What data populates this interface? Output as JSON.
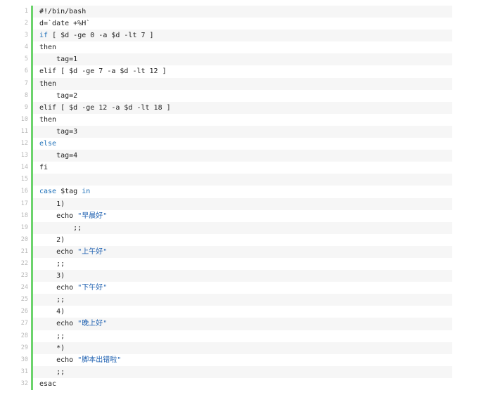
{
  "code": {
    "lines": [
      {
        "number": "1",
        "parts": [
          {
            "t": "#!/bin/bash",
            "c": "comment"
          }
        ]
      },
      {
        "number": "2",
        "parts": [
          {
            "t": "d=`date +%H`",
            "c": "plain"
          }
        ]
      },
      {
        "number": "3",
        "parts": [
          {
            "t": "if",
            "c": "kw"
          },
          {
            "t": " [ $d -ge 0 -a $d -lt 7 ]",
            "c": "plain"
          }
        ]
      },
      {
        "number": "4",
        "parts": [
          {
            "t": "then",
            "c": "plain"
          }
        ]
      },
      {
        "number": "5",
        "parts": [
          {
            "t": "    tag=1",
            "c": "plain"
          }
        ]
      },
      {
        "number": "6",
        "parts": [
          {
            "t": "elif [ $d -ge 7 -a $d -lt 12 ]",
            "c": "plain"
          }
        ]
      },
      {
        "number": "7",
        "parts": [
          {
            "t": "then",
            "c": "plain"
          }
        ]
      },
      {
        "number": "8",
        "parts": [
          {
            "t": "    tag=2",
            "c": "plain"
          }
        ]
      },
      {
        "number": "9",
        "parts": [
          {
            "t": "elif [ $d -ge 12 -a $d -lt 18 ]",
            "c": "plain"
          }
        ]
      },
      {
        "number": "10",
        "parts": [
          {
            "t": "then",
            "c": "plain"
          }
        ]
      },
      {
        "number": "11",
        "parts": [
          {
            "t": "    tag=3",
            "c": "plain"
          }
        ]
      },
      {
        "number": "12",
        "parts": [
          {
            "t": "else",
            "c": "kw"
          }
        ]
      },
      {
        "number": "13",
        "parts": [
          {
            "t": "    tag=4",
            "c": "plain"
          }
        ]
      },
      {
        "number": "14",
        "parts": [
          {
            "t": "fi",
            "c": "plain"
          }
        ]
      },
      {
        "number": "15",
        "parts": [
          {
            "t": "",
            "c": "plain"
          }
        ]
      },
      {
        "number": "16",
        "parts": [
          {
            "t": "case",
            "c": "kw"
          },
          {
            "t": " $tag ",
            "c": "plain"
          },
          {
            "t": "in",
            "c": "kw"
          }
        ]
      },
      {
        "number": "17",
        "parts": [
          {
            "t": "    1)",
            "c": "plain"
          }
        ]
      },
      {
        "number": "18",
        "parts": [
          {
            "t": "    echo ",
            "c": "plain"
          },
          {
            "t": "\"早晨好\"",
            "c": "str"
          }
        ]
      },
      {
        "number": "19",
        "parts": [
          {
            "t": "        ;;",
            "c": "plain"
          }
        ]
      },
      {
        "number": "20",
        "parts": [
          {
            "t": "    2)",
            "c": "plain"
          }
        ]
      },
      {
        "number": "21",
        "parts": [
          {
            "t": "    echo ",
            "c": "plain"
          },
          {
            "t": "\"上午好\"",
            "c": "str"
          }
        ]
      },
      {
        "number": "22",
        "parts": [
          {
            "t": "    ;;",
            "c": "plain"
          }
        ]
      },
      {
        "number": "23",
        "parts": [
          {
            "t": "    3)",
            "c": "plain"
          }
        ]
      },
      {
        "number": "24",
        "parts": [
          {
            "t": "    echo ",
            "c": "plain"
          },
          {
            "t": "\"下午好\"",
            "c": "str"
          }
        ]
      },
      {
        "number": "25",
        "parts": [
          {
            "t": "    ;;",
            "c": "plain"
          }
        ]
      },
      {
        "number": "26",
        "parts": [
          {
            "t": "    4)",
            "c": "plain"
          }
        ]
      },
      {
        "number": "27",
        "parts": [
          {
            "t": "    echo ",
            "c": "plain"
          },
          {
            "t": "\"晚上好\"",
            "c": "str"
          }
        ]
      },
      {
        "number": "28",
        "parts": [
          {
            "t": "    ;;",
            "c": "plain"
          }
        ]
      },
      {
        "number": "29",
        "parts": [
          {
            "t": "    *)",
            "c": "plain"
          }
        ]
      },
      {
        "number": "30",
        "parts": [
          {
            "t": "    echo ",
            "c": "plain"
          },
          {
            "t": "\"脚本出错啦\"",
            "c": "str"
          }
        ]
      },
      {
        "number": "31",
        "parts": [
          {
            "t": "    ;;",
            "c": "plain"
          }
        ]
      },
      {
        "number": "32",
        "parts": [
          {
            "t": "esac",
            "c": "plain"
          }
        ]
      }
    ]
  },
  "colors": {
    "gutter_bar": "#6cd36c",
    "keyword": "#1c6fb8",
    "string": "#1c5fb0",
    "line_number": "#b8b8b8",
    "stripe": "#f6f6f6"
  }
}
